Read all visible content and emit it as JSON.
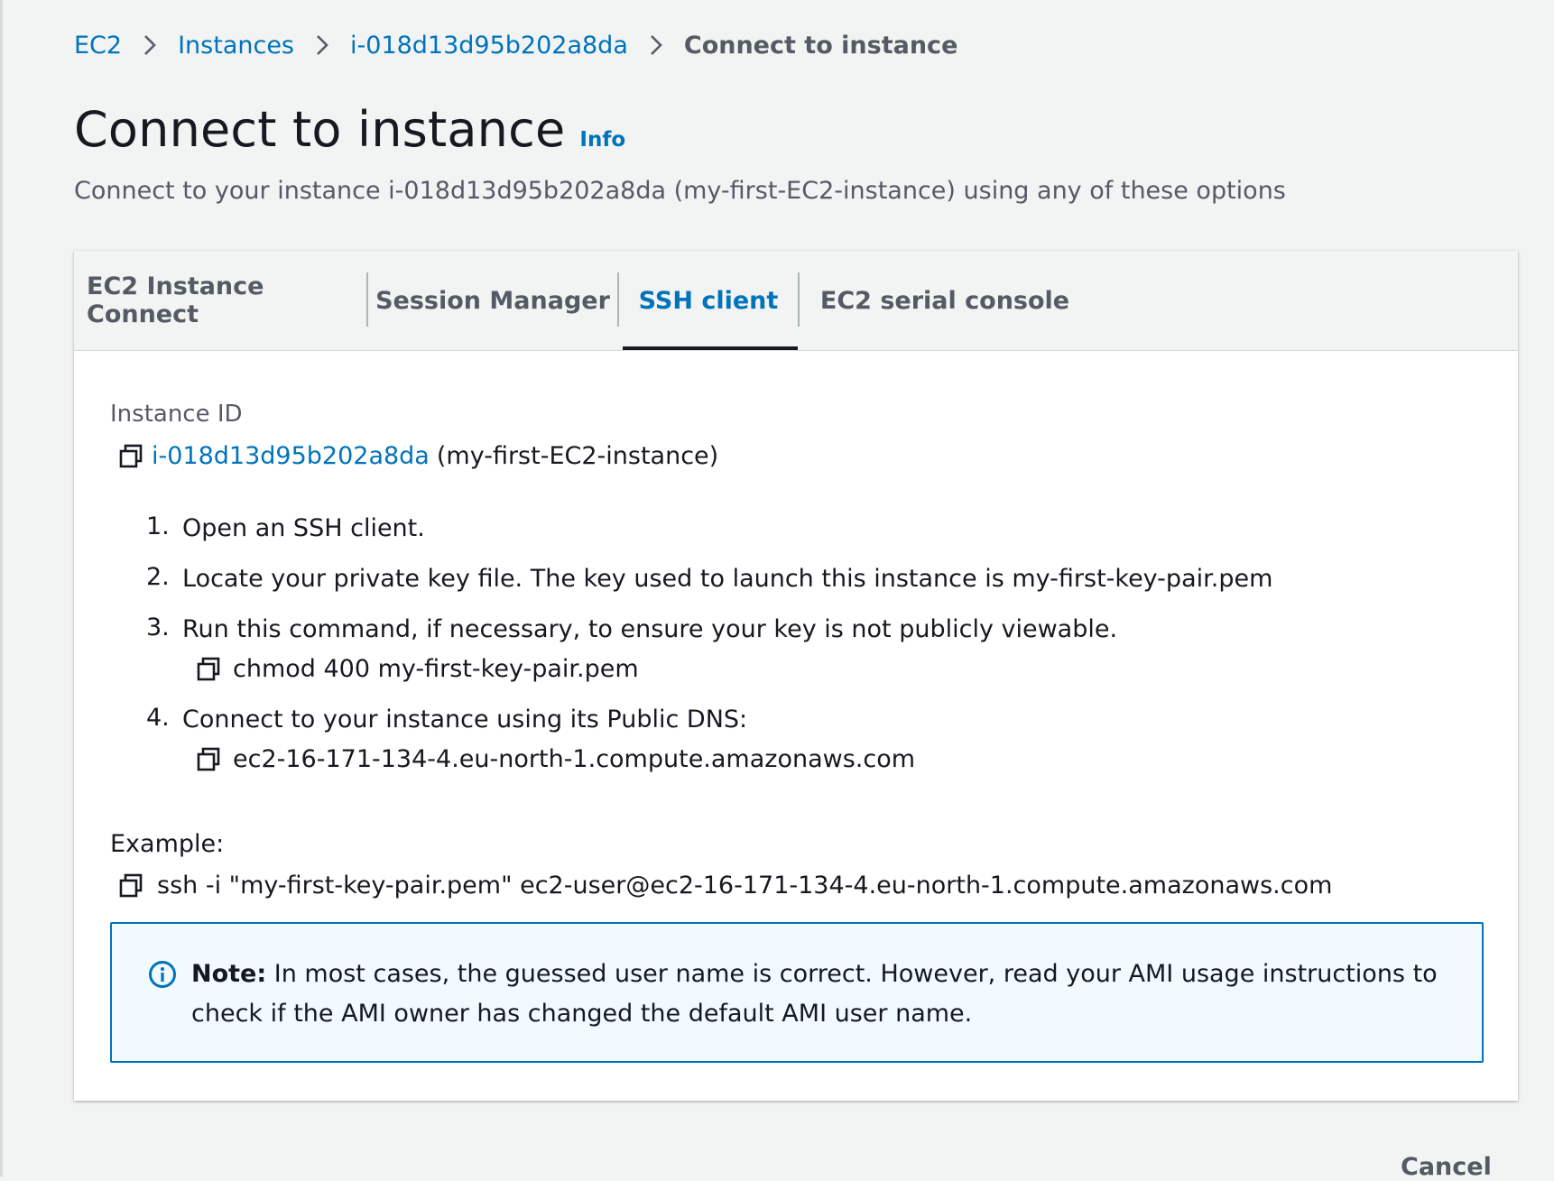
{
  "breadcrumb": {
    "items": [
      "EC2",
      "Instances",
      "i-018d13d95b202a8da"
    ],
    "current": "Connect to instance"
  },
  "page": {
    "title": "Connect to instance",
    "info_link": "Info",
    "subtitle": "Connect to your instance i-018d13d95b202a8da (my-first-EC2-instance) using any of these options"
  },
  "tabs": [
    {
      "label": "EC2 Instance Connect",
      "active": false
    },
    {
      "label": "Session Manager",
      "active": false
    },
    {
      "label": "SSH client",
      "active": true
    },
    {
      "label": "EC2 serial console",
      "active": false
    }
  ],
  "instance": {
    "label": "Instance ID",
    "id": "i-018d13d95b202a8da",
    "name": "(my-first-EC2-instance)"
  },
  "steps": [
    {
      "num": "1.",
      "text": "Open an SSH client."
    },
    {
      "num": "2.",
      "text": "Locate your private key file. The key used to launch this instance is my-first-key-pair.pem"
    },
    {
      "num": "3.",
      "text": "Run this command, if necessary, to ensure your key is not publicly viewable.",
      "command": "chmod 400 my-first-key-pair.pem"
    },
    {
      "num": "4.",
      "text": "Connect to your instance using its Public DNS:",
      "command": "ec2-16-171-134-4.eu-north-1.compute.amazonaws.com"
    }
  ],
  "example": {
    "label": "Example:",
    "command": "ssh -i \"my-first-key-pair.pem\" ec2-user@ec2-16-171-134-4.eu-north-1.compute.amazonaws.com"
  },
  "note": {
    "label": "Note:",
    "text": " In most cases, the guessed user name is correct. However, read your AMI usage instructions to check if the AMI owner has changed the default AMI user name."
  },
  "footer": {
    "cancel_label": "Cancel"
  },
  "colors": {
    "link": "#0073bb",
    "text": "#16191f",
    "muted": "#545b64",
    "background": "#f2f3f3",
    "note_background": "#f1faff"
  },
  "icons": {
    "breadcrumb_separator": "chevron-right-icon",
    "copy": "copy-icon",
    "note": "info-circle-icon"
  }
}
